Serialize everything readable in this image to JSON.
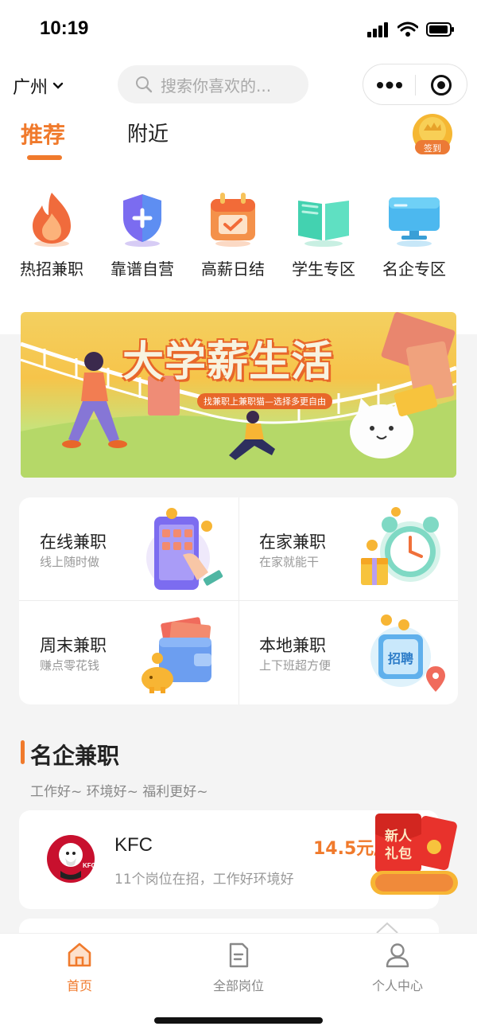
{
  "status_bar": {
    "time": "10:19"
  },
  "header": {
    "city": "广州",
    "search_placeholder": "搜索你喜欢的...",
    "signin_label": "签到"
  },
  "tabs": [
    {
      "label": "推荐",
      "active": true
    },
    {
      "label": "附近",
      "active": false
    }
  ],
  "categories": [
    {
      "label": "热招兼职",
      "icon": "fire-icon"
    },
    {
      "label": "靠谱自营",
      "icon": "shield-plus-icon"
    },
    {
      "label": "高薪日结",
      "icon": "calendar-check-icon"
    },
    {
      "label": "学生专区",
      "icon": "book-icon"
    },
    {
      "label": "名企专区",
      "icon": "monitor-icon"
    }
  ],
  "banner": {
    "title": "大学薪生活",
    "subtitle": "找兼职上兼职猫—选择多更自由"
  },
  "job_types": [
    {
      "title": "在线兼职",
      "subtitle": "线上随时做",
      "icon": "phone-tap-icon"
    },
    {
      "title": "在家兼职",
      "subtitle": "在家就能干",
      "icon": "alarm-clock-icon"
    },
    {
      "title": "周末兼职",
      "subtitle": "赚点零花钱",
      "icon": "wallet-icon"
    },
    {
      "title": "本地兼职",
      "subtitle": "上下班超方便",
      "icon": "recruit-bag-icon"
    }
  ],
  "section": {
    "title": "名企兼职",
    "subtitle": "工作好~ 环境好~ 福利更好~"
  },
  "companies": [
    {
      "name": "KFC",
      "description": "11个岗位在招，工作好环境好",
      "salary": "14.5元/",
      "logo_text": "KFC"
    }
  ],
  "gift": {
    "label_line1": "新人",
    "label_line2": "礼包"
  },
  "tabbar": [
    {
      "label": "首页",
      "icon": "home-icon",
      "active": true
    },
    {
      "label": "全部岗位",
      "icon": "document-icon",
      "active": false
    },
    {
      "label": "个人中心",
      "icon": "user-icon",
      "active": false
    }
  ],
  "colors": {
    "accent": "#f07a2c",
    "background": "#f4f4f4"
  }
}
